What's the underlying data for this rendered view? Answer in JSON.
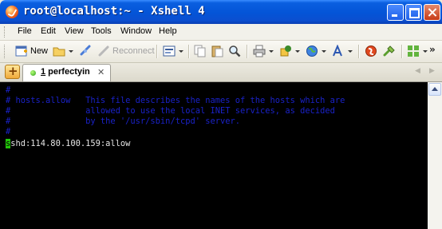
{
  "window": {
    "title": "root@localhost:~ - Xshell 4"
  },
  "menu": [
    "File",
    "Edit",
    "View",
    "Tools",
    "Window",
    "Help"
  ],
  "toolbar": {
    "new_label": "New",
    "reconnect_label": "Reconnect"
  },
  "tabs": [
    {
      "number": "1",
      "name": " perfectyin",
      "status": "connected"
    }
  ],
  "terminal": {
    "lines": [
      "#",
      "# hosts.allow   This file describes the names of the hosts which are",
      "#               allowed to use the local INET services, as decided",
      "#               by the '/usr/sbin/tcpd' server.",
      "#"
    ],
    "entry_cursor_char": "s",
    "entry_rest": "shd:114.80.100.159:allow"
  },
  "colors": {
    "comment": "#1a22c8",
    "cursor": "#22c40a",
    "title_bar": "#0454d7"
  }
}
